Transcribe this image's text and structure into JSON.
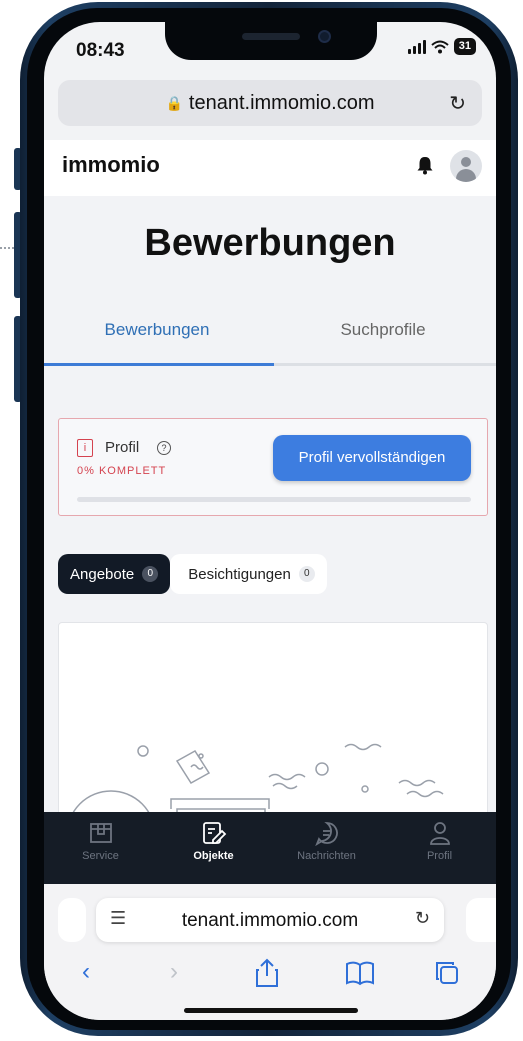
{
  "status_bar": {
    "time": "08:43",
    "battery": "31"
  },
  "browser": {
    "url": "tenant.immomio.com"
  },
  "header": {
    "logo": "immomio"
  },
  "page": {
    "title": "Bewerbungen",
    "tabs": [
      {
        "label": "Bewerbungen",
        "active": true
      },
      {
        "label": "Suchprofile",
        "active": false
      }
    ]
  },
  "profile_card": {
    "info_glyph": "i",
    "label": "Profil",
    "help_glyph": "?",
    "status": "0% KOMPLETT",
    "progress": 0,
    "button_label": "Profil vervollständigen"
  },
  "filters": [
    {
      "label": "Angebote",
      "count": "0",
      "active": true
    },
    {
      "label": "Besichtigungen",
      "count": "0",
      "active": false
    }
  ],
  "bottom_nav": [
    {
      "label": "Service",
      "icon": "box-icon",
      "active": false
    },
    {
      "label": "Objekte",
      "icon": "document-edit-icon",
      "active": true
    },
    {
      "label": "Nachrichten",
      "icon": "chat-bubble-icon",
      "active": false
    },
    {
      "label": "Profil",
      "icon": "person-icon",
      "active": false
    }
  ],
  "colors": {
    "accent": "#3d7de0",
    "warning": "#d4434f",
    "nav_bg": "#151c26"
  }
}
